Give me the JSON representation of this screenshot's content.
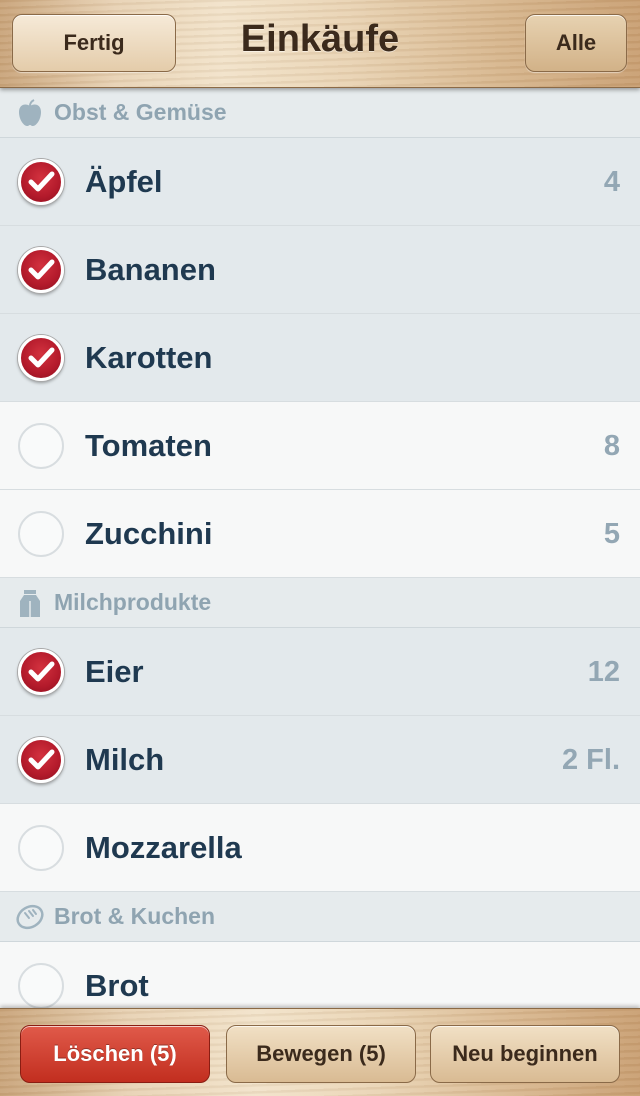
{
  "header": {
    "title": "Einkäufe",
    "done_label": "Fertig",
    "all_label": "Alle"
  },
  "sections": [
    {
      "title": "Obst & Gemüse",
      "icon": "apple-icon",
      "items": [
        {
          "name": "Äpfel",
          "qty": "4",
          "checked": true
        },
        {
          "name": "Bananen",
          "qty": "",
          "checked": true
        },
        {
          "name": "Karotten",
          "qty": "",
          "checked": true
        },
        {
          "name": "Tomaten",
          "qty": "8",
          "checked": false
        },
        {
          "name": "Zucchini",
          "qty": "5",
          "checked": false
        }
      ]
    },
    {
      "title": "Milchprodukte",
      "icon": "milk-carton-icon",
      "items": [
        {
          "name": "Eier",
          "qty": "12",
          "checked": true
        },
        {
          "name": "Milch",
          "qty": "2 Fl.",
          "checked": true
        },
        {
          "name": "Mozzarella",
          "qty": "",
          "checked": false
        }
      ]
    },
    {
      "title": "Brot & Kuchen",
      "icon": "bread-icon",
      "items": [
        {
          "name": "Brot",
          "qty": "",
          "checked": false
        }
      ]
    }
  ],
  "toolbar": {
    "delete_label": "Löschen (5)",
    "move_label": "Bewegen (5)",
    "reset_label": "Neu beginnen"
  },
  "colors": {
    "checked_red": "#b31a2b",
    "item_text": "#1f3950",
    "section_text": "#8fa4b1",
    "delete_red": "#c22e1f"
  }
}
